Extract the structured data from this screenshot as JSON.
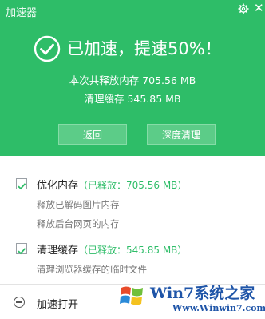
{
  "header": {
    "title": "加速器"
  },
  "result": {
    "headline": "已加速，提速50%！",
    "memory_line": "本次共释放内存 705.56 MB",
    "cache_line": "清理缓存 545.85 MB"
  },
  "buttons": {
    "back": "返回",
    "deep_clean": "深度清理"
  },
  "items": [
    {
      "title": "优化内存",
      "released": "（已释放：705.56 MB）",
      "checked": true,
      "details": [
        "释放已解码图片内存",
        "释放后台网页的内存"
      ]
    },
    {
      "title": "清理缓存",
      "released": "（已释放：545.85 MB）",
      "checked": true,
      "details": [
        "清理浏览器缓存的临时文件"
      ]
    }
  ],
  "footer": {
    "accelerate_open": "加速打开"
  },
  "watermark": {
    "brand": "Win7系统之家",
    "url": "Www.Winwin7.com"
  },
  "colors": {
    "accent": "#2ebd68",
    "watermark": "#1f55a8"
  }
}
